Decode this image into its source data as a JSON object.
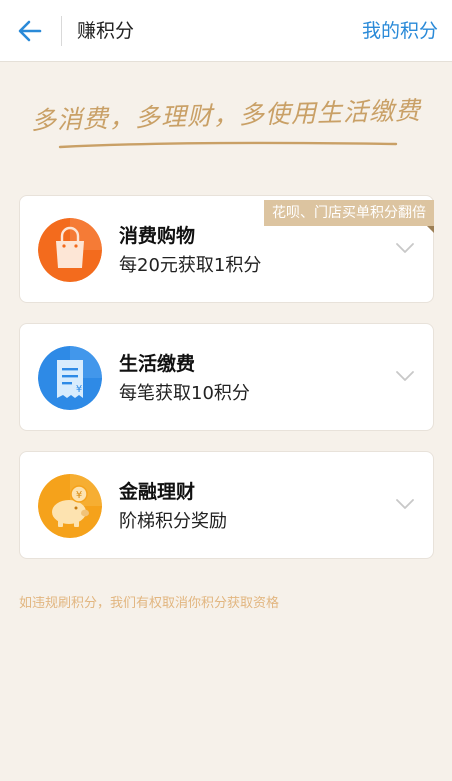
{
  "header": {
    "title": "赚积分",
    "right_link": "我的积分"
  },
  "slogan": {
    "text": "多消费，多理财，多使用生活缴费"
  },
  "cards": [
    {
      "title": "消费购物",
      "desc": "每20元获取1积分",
      "icon": "shopping-bag-icon",
      "tag": "花呗、门店买单积分翻倍"
    },
    {
      "title": "生活缴费",
      "desc": "每笔获取10积分",
      "icon": "bill-yuan-icon"
    },
    {
      "title": "金融理财",
      "desc": "阶梯积分奖励",
      "icon": "piggy-bank-icon"
    }
  ],
  "disclaimer": "如违规刷积分，我们有权取消你积分获取资格",
  "colors": {
    "accent": "#2a8ad8",
    "background": "#f6f1ea",
    "gold": "#c9a066",
    "tag": "#dcc4a0",
    "disclaimer": "#e2b680"
  }
}
